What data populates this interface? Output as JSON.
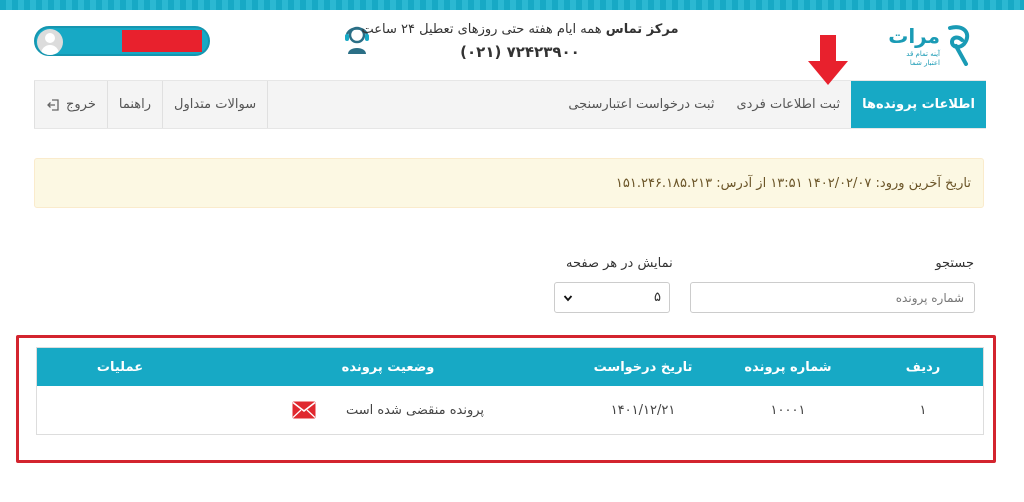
{
  "header": {
    "logo": {
      "name": "مرات",
      "tagline": "آینه تمام قد اعتبار شما"
    },
    "contact": {
      "label": "مرکز تماس",
      "hours": "همه ایام هفته حتی روزهای تعطیل ۲۴ ساعت",
      "phone": "(۰۲۱) ۷۲۴۲۳۹۰۰"
    }
  },
  "nav": {
    "items": [
      {
        "label": "اطلاعات پرونده‌ها"
      },
      {
        "label": "ثبت اطلاعات فردی"
      },
      {
        "label": "ثبت درخواست اعتبارسنجی"
      }
    ],
    "right_items": [
      {
        "label": "سوالات متداول"
      },
      {
        "label": "راهنما"
      },
      {
        "label": "خروج"
      }
    ]
  },
  "info": {
    "text": "تاریخ آخرین ورود: ۱۴۰۲/۰۲/۰۷ ۱۳:۵۱ از آدرس: ۱۵۱.۲۴۶.۱۸۵.۲۱۳"
  },
  "filters": {
    "search_label": "جستجو",
    "search_placeholder": "شماره پرونده",
    "perpage_label": "نمایش در هر صفحه",
    "perpage_value": "۵"
  },
  "table": {
    "columns": [
      "ردیف",
      "شماره پرونده",
      "تاریخ درخواست",
      "وضعیت پرونده",
      "عملیات"
    ],
    "rows": [
      {
        "index": "۱",
        "file_no": "۱۰۰۰۱",
        "date": "۱۴۰۱/۱۲/۲۱",
        "status": "پرونده منقضی شده است",
        "actions": ""
      }
    ]
  },
  "colors": {
    "accent": "#17a9c5",
    "highlight": "#d3242e",
    "info_bg": "#fcf8e3",
    "username_mask": "#e8212d"
  },
  "icons": [
    "logo-mark",
    "headset-icon",
    "user-avatar-icon",
    "exit-icon",
    "down-arrow-annotation",
    "chevron-down-icon",
    "mail-icon"
  ]
}
